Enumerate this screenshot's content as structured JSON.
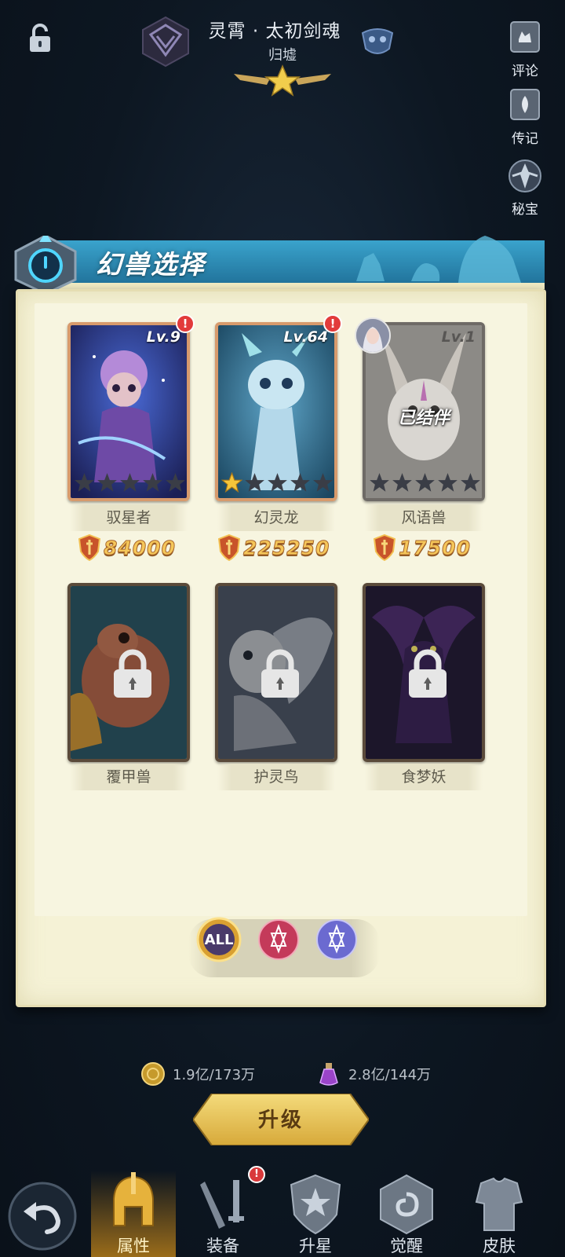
{
  "header": {
    "hero_name": "灵霄 · 太初剑魂",
    "hero_faction": "归墟",
    "side_buttons": [
      {
        "label": "评论",
        "icon": "comment-icon"
      },
      {
        "label": "传记",
        "icon": "biography-icon"
      },
      {
        "label": "秘宝",
        "icon": "treasure-icon"
      }
    ]
  },
  "panel": {
    "title": "幻兽选择",
    "cards": [
      {
        "name": "驭星者",
        "level": "Lv.9",
        "power": "84000",
        "stars_filled": 0,
        "stars_total": 5,
        "has_alert": true,
        "alert_text": "!",
        "state": "owned"
      },
      {
        "name": "幻灵龙",
        "level": "Lv.64",
        "power": "225250",
        "stars_filled": 1,
        "stars_total": 5,
        "has_alert": true,
        "alert_text": "!",
        "state": "owned"
      },
      {
        "name": "风语兽",
        "level": "Lv.1",
        "power": "17500",
        "stars_filled": 0,
        "stars_total": 5,
        "has_alert": false,
        "state": "bonded",
        "bond_label": "已结伴"
      },
      {
        "name": "覆甲兽",
        "state": "locked"
      },
      {
        "name": "护灵鸟",
        "state": "locked"
      },
      {
        "name": "食梦妖",
        "state": "locked"
      }
    ],
    "filters": [
      {
        "label": "ALL",
        "active": true
      },
      {
        "label": "",
        "icon": "red-hexagram-icon",
        "active": false
      },
      {
        "label": "",
        "icon": "blue-hexagram-icon",
        "active": false
      }
    ]
  },
  "resources": [
    {
      "icon": "gold-coin-icon",
      "value": "1.9亿/173万"
    },
    {
      "icon": "potion-icon",
      "value": "2.8亿/144万"
    }
  ],
  "upgrade_button": {
    "label": "升级"
  },
  "bottom_nav": {
    "items": [
      {
        "label": "属性",
        "active": true
      },
      {
        "label": "装备",
        "active": false,
        "badge": "!"
      },
      {
        "label": "升星",
        "active": false
      },
      {
        "label": "觉醒",
        "active": false
      },
      {
        "label": "皮肤",
        "active": false
      }
    ]
  },
  "colors": {
    "background": "#0d1722",
    "panel_bg": "#f5f2d6",
    "header_blue": "#2f8fb8",
    "power_gold": "#f5c75a",
    "upgrade_gold": "#e7c45a",
    "alert_red": "#e23b3b"
  }
}
